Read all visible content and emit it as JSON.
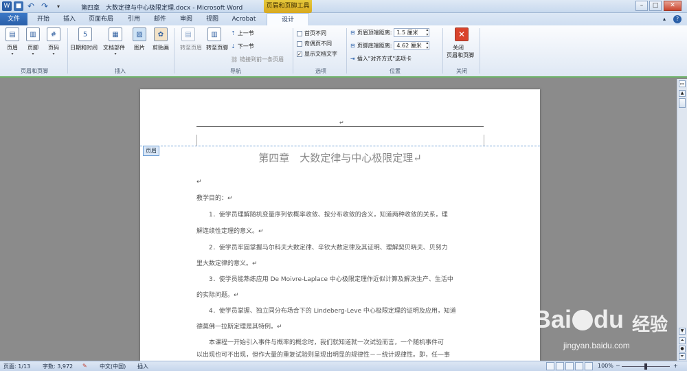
{
  "titlebar": {
    "title": "第四章　大数定律与中心极限定理.docx - Microsoft Word",
    "context_tab": "页眉和页脚工具",
    "qa_word": "W",
    "qa_save": "■",
    "qa_undo": "↶",
    "qa_redo": "↷",
    "min": "–",
    "max": "□",
    "close": "✕"
  },
  "tabs": {
    "file": "文件",
    "items": [
      "开始",
      "插入",
      "页面布局",
      "引用",
      "邮件",
      "审阅",
      "视图",
      "Acrobat",
      "设计"
    ]
  },
  "ribbon": {
    "header": "页眉",
    "footer": "页脚",
    "page_number": "页码",
    "group_header_footer": "页眉和页脚",
    "datetime": "日期和时间",
    "docparts": "文档部件",
    "picture": "图片",
    "clipart": "剪贴画",
    "group_insert": "插入",
    "goto_header": "转至页眉",
    "goto_footer": "转至页脚",
    "prev_section": "上一节",
    "next_section": "下一节",
    "link_prev": "链接到前一条页眉",
    "group_nav": "导航",
    "diff_first": "首页不同",
    "diff_oddeven": "奇偶页不同",
    "show_doc_text": "显示文档文字",
    "group_options": "选项",
    "header_top": "页眉顶端距离:",
    "header_top_val": "1.5 厘米",
    "footer_bottom": "页脚底端距离:",
    "footer_bottom_val": "4.62 厘米",
    "insert_align_tab": "插入\"对齐方式\"选项卡",
    "group_position": "位置",
    "close_label": "关闭\n页眉和页脚",
    "close_l1": "关闭",
    "close_l2": "页眉和页脚",
    "group_close": "关闭"
  },
  "document": {
    "header_tag": "页眉",
    "header_mark": "↵",
    "title": "第四章　大数定律与中心极限定理↵",
    "lines": [
      "↵",
      "教学目的：↵",
      "　　1．使学员理解随机变量序列依概率收敛、按分布收敛的含义，知道两种收敛的关系，理",
      "解连续性定理的意义。↵",
      "　　2．使学员牢固掌握马尔科夫大数定律、辛钦大数定律及其证明、理解契贝晓夫、贝努力",
      "里大数定律的意义。↵",
      "　　3．使学员能熟练应用 De  Moivre-Laplace 中心极限定理作近似计算及解决生产、生活中",
      "的实际问题。↵",
      "　　4．使学员掌握、独立同分布场合下的 Lindeberg-Leve 中心极限定理的证明及应用，知道",
      "德莫佛一拉斯定理是其特例。↵",
      "　　本课程一开始引入事件与概率的概念时，我们就知道就一次试验而言，一个随机事件可",
      "以出现也可不出现，但作大量的重复试验则呈现出明显的规律性－－统计规律性。即，任一事"
    ]
  },
  "statusbar": {
    "page": "页面: 1/13",
    "words": "字数: 3,972",
    "lang": "中文(中国)",
    "mode": "插入",
    "zoom": "100%",
    "zoom_minus": "−",
    "zoom_plus": "+"
  },
  "watermark": {
    "brand": "Bai",
    "brand2": "du",
    "cn": "经验",
    "url": "jingyan.baidu.com"
  },
  "colors": {
    "accent": "#2a5fa8",
    "context": "#d8a920",
    "ribbon_border": "#6fb36a"
  }
}
